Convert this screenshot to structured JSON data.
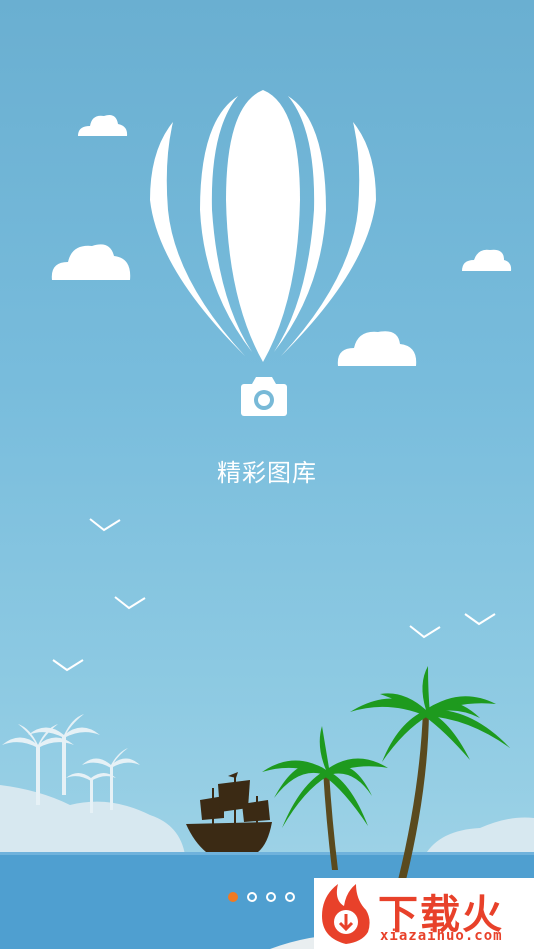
{
  "app": {
    "title": "精彩图库"
  },
  "pager": {
    "total_pages": 4,
    "active_page": 1
  },
  "watermark": {
    "brand": "下载火",
    "url": "xiazaihuo.com"
  },
  "icons": {
    "balloon": "hot-air-balloon-icon",
    "camera": "camera-icon"
  },
  "colors": {
    "sky_top": "#6aafd1",
    "sea": "#4f9fd0",
    "accent_dot": "#f07a22",
    "palm_leaf": "#1e9a1e",
    "ship": "#3b2a14",
    "watermark_red": "#e8412a"
  }
}
